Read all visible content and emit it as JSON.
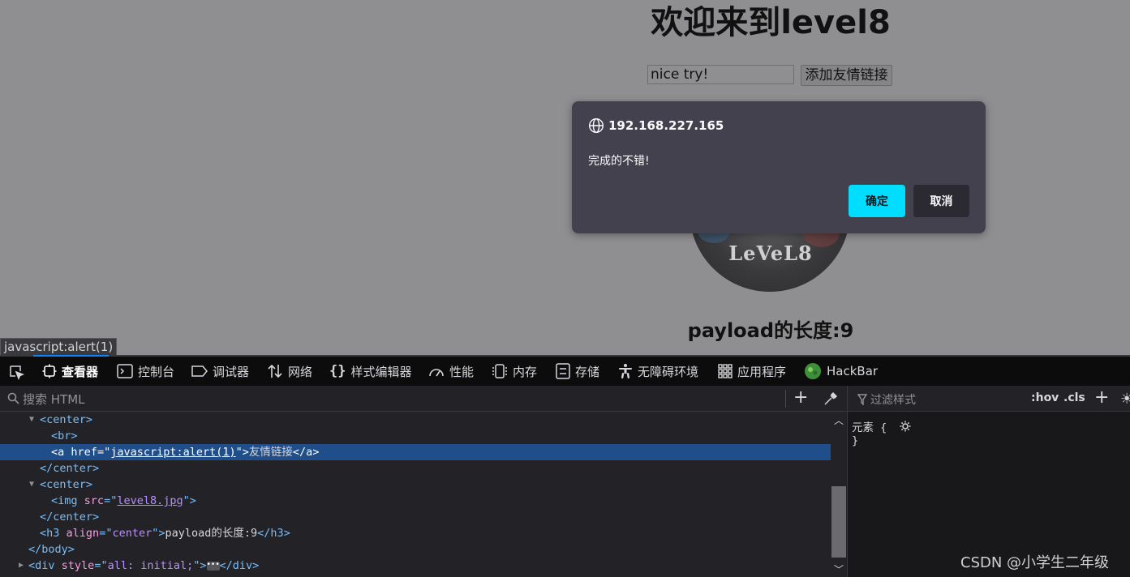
{
  "page": {
    "title": "欢迎来到level8",
    "input_value": "nice try!",
    "button_label": "添加友情链接",
    "disc_logo": "LeVeL8",
    "payload_length_text": "payload的长度:9",
    "status_url": "javascript:alert(1)"
  },
  "dialog": {
    "origin": "192.168.227.165",
    "message": "完成的不错!",
    "ok_label": "确定",
    "cancel_label": "取消",
    "ok_color": "#00ddff"
  },
  "devtools": {
    "tabs": [
      {
        "label": "查看器",
        "icon": "inspector-icon"
      },
      {
        "label": "控制台",
        "icon": "console-icon"
      },
      {
        "label": "调试器",
        "icon": "debugger-icon"
      },
      {
        "label": "网络",
        "icon": "network-icon"
      },
      {
        "label": "样式编辑器",
        "icon": "style-editor-icon"
      },
      {
        "label": "性能",
        "icon": "performance-icon"
      },
      {
        "label": "内存",
        "icon": "memory-icon"
      },
      {
        "label": "存储",
        "icon": "storage-icon"
      },
      {
        "label": "无障碍环境",
        "icon": "accessibility-icon"
      },
      {
        "label": "应用程序",
        "icon": "application-icon"
      },
      {
        "label": "HackBar",
        "icon": "hackbar-icon"
      }
    ],
    "search_placeholder": "搜索 HTML",
    "markup": {
      "center_open": "center",
      "br": "br",
      "a_tag": "a",
      "a_attr": "href",
      "a_value": "javascript:alert(1)",
      "a_text": "友情链接",
      "center_close": "/center",
      "img_tag": "img",
      "img_attr": "src",
      "img_value": "level8.jpg",
      "h3_tag": "h3",
      "h3_attr": "align",
      "h3_value": "center",
      "h3_text": "payload的长度:9",
      "body_close": "/body",
      "div_tag": "div",
      "div_attr": "style",
      "div_value": "all: initial;"
    },
    "rules": {
      "filter_placeholder": "过滤样式",
      "hov": ":hov",
      "cls": ".cls",
      "element_rule": "元素 {",
      "close_brace": "}"
    }
  },
  "watermark": "CSDN @小学生二年级"
}
